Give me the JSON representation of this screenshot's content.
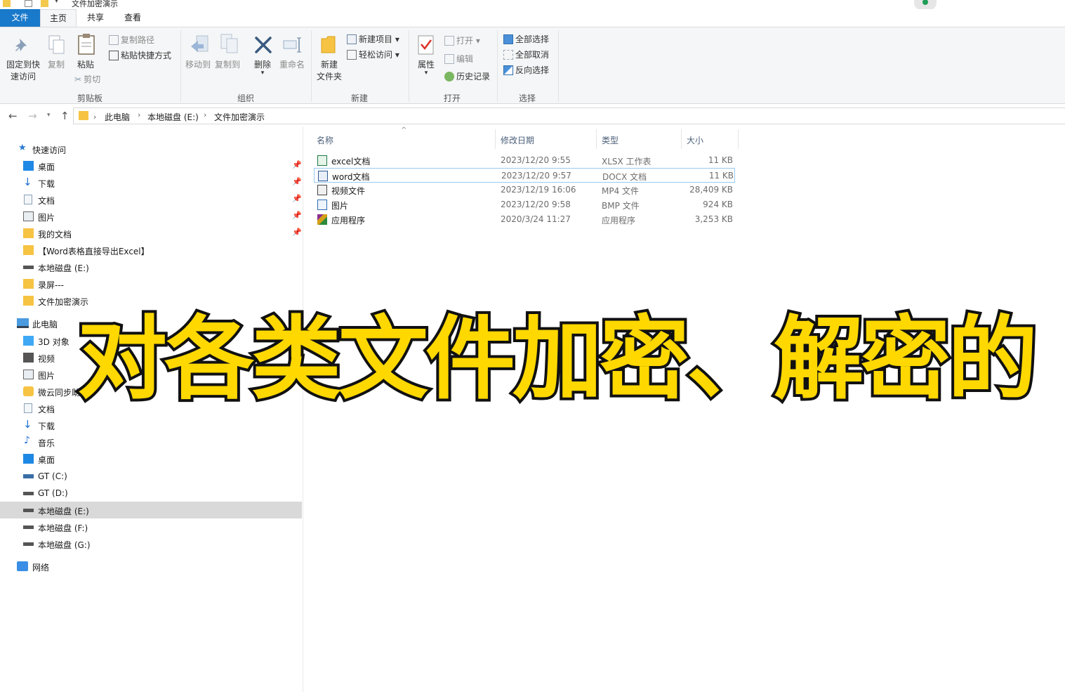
{
  "window": {
    "title": "文件加密演示"
  },
  "ribbon_tabs": [
    "文件",
    "主页",
    "共享",
    "查看"
  ],
  "ribbon": {
    "clipboard": {
      "pin_label_1": "固定到快",
      "pin_label_2": "速访问",
      "copy": "复制",
      "paste": "粘贴",
      "copy_path": "复制路径",
      "paste_shortcut": "粘贴快捷方式",
      "cut": "剪切",
      "group": "剪贴板"
    },
    "organize": {
      "move_to": "移动到",
      "copy_to": "复制到",
      "delete": "删除",
      "rename": "重命名",
      "group": "组织"
    },
    "new": {
      "new_folder_1": "新建",
      "new_folder_2": "文件夹",
      "new_item": "新建项目 ▾",
      "easy_access": "轻松访问 ▾",
      "group": "新建"
    },
    "open": {
      "properties": "属性",
      "open": "打开 ▾",
      "edit": "编辑",
      "history": "历史记录",
      "group": "打开"
    },
    "select": {
      "select_all": "全部选择",
      "select_none": "全部取消",
      "invert": "反向选择",
      "group": "选择"
    }
  },
  "address": {
    "crumbs": [
      "此电脑",
      "本地磁盘 (E:)",
      "文件加密演示"
    ]
  },
  "nav": {
    "quick_access": "快速访问",
    "quick_items": [
      "桌面",
      "下载",
      "文档",
      "图片",
      "我的文档",
      "【Word表格直接导出Excel】",
      "本地磁盘 (E:)",
      "录屏---",
      "文件加密演示"
    ],
    "this_pc": "此电脑",
    "pc_items": [
      "3D 对象",
      "视频",
      "图片",
      "微云同步助手",
      "文档",
      "下载",
      "音乐",
      "桌面",
      "GT (C:)",
      "GT (D:)",
      "本地磁盘 (E:)",
      "本地磁盘 (F:)",
      "本地磁盘 (G:)"
    ],
    "network": "网络"
  },
  "columns": {
    "name": "名称",
    "date": "修改日期",
    "type": "类型",
    "size": "大小"
  },
  "files": [
    {
      "name": "excel文档",
      "date": "2023/12/20 9:55",
      "type": "XLSX 工作表",
      "size": "11 KB",
      "icon": "excel-icon",
      "color": "#1d7a45"
    },
    {
      "name": "word文档",
      "date": "2023/12/20 9:57",
      "type": "DOCX 文档",
      "size": "11 KB",
      "icon": "word-icon",
      "color": "#2b5797"
    },
    {
      "name": "视频文件",
      "date": "2023/12/19 16:06",
      "type": "MP4 文件",
      "size": "28,409 KB",
      "icon": "video-icon",
      "color": "#444444"
    },
    {
      "name": "图片",
      "date": "2023/12/20 9:58",
      "type": "BMP 文件",
      "size": "924 KB",
      "icon": "image-file-icon",
      "color": "#2b6cb0"
    },
    {
      "name": "应用程序",
      "date": "2020/3/24 11:27",
      "type": "应用程序",
      "size": "3,253 KB",
      "icon": "app-icon",
      "color": "#8b2f8f"
    }
  ],
  "caption": "对各类文件加密、解密的"
}
